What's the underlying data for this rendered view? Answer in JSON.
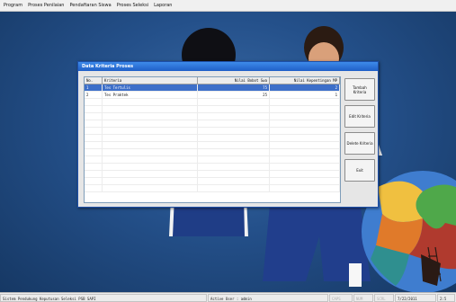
{
  "menubar": {
    "items": [
      "Program",
      "Proses Penilaian",
      "Pendaftaran Siswa",
      "Proses Seleksi",
      "Laporan"
    ]
  },
  "dialog": {
    "title": "Data Kriteria Proses",
    "table": {
      "headers": [
        "No.",
        "Kriteria",
        "Nilai Bobot Swa",
        "Nilai Kepentingan MP"
      ],
      "rows": [
        {
          "no": "1",
          "kriteria": "Tes Tertulis",
          "bobot": "75",
          "kepentingan": "2"
        },
        {
          "no": "2",
          "kriteria": "Tes Praktek",
          "bobot": "25",
          "kepentingan": "1"
        }
      ]
    },
    "buttons": {
      "tambah": "Tambah Kriteria",
      "edit": "Edit Kriteria",
      "delete": "Delete Kriteria",
      "exit": "Exit"
    }
  },
  "statusbar": {
    "app_name": "Sistem Pendukung Keputusan Seleksi PSB SAPI",
    "active_user": "Active User : admin",
    "caps": "CAPS",
    "num": "NUM",
    "scrl": "SCRL",
    "date": "7/22/2011",
    "time": "2:5"
  },
  "colors": {
    "desktop_bg": "#24508a",
    "selection": "#3d6fc9",
    "titlebar": "#1f5fc7"
  }
}
